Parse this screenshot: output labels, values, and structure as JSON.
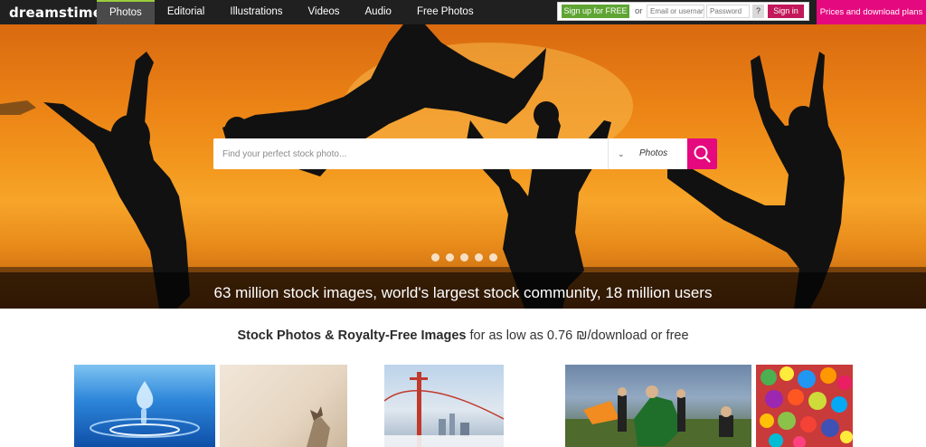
{
  "brand": {
    "logo_text": "dreamstime",
    "logo_dot": "."
  },
  "nav": {
    "items": [
      "Photos",
      "Editorial",
      "Illustrations",
      "Videos",
      "Audio",
      "Free Photos"
    ],
    "active_index": 0
  },
  "account": {
    "signup_label": "Sign up for FREE",
    "or_label": "or",
    "email_placeholder": "Email or username",
    "password_placeholder": "Password",
    "help_label": "?",
    "signin_label": "Sign in"
  },
  "prices_label": "Prices and download plans",
  "hero": {
    "search_placeholder": "Find your perfect stock photo...",
    "search_type": "Photos",
    "slide_count": 5,
    "tagline": "63 million stock images, world's largest stock community, 18 million users"
  },
  "headline": {
    "bold": "Stock Photos & Royalty-Free Images",
    "rest": " for as low as 0.76 ₪/download or free"
  },
  "colors": {
    "brand_green": "#9bcb3c",
    "signup_green": "#5fa534",
    "signin": "#c2185b",
    "accent_pink": "#e5097f"
  }
}
